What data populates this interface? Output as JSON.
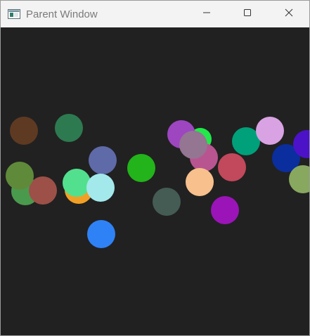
{
  "window": {
    "title": "Parent Window",
    "app_icon": "window-app-icon",
    "controls": [
      "minimize-icon",
      "maximize-icon",
      "close-icon"
    ]
  },
  "canvas": {
    "background": "#212121",
    "circles": [
      {
        "name": "circle-1",
        "color": "#5e3a22"
      },
      {
        "name": "circle-2",
        "color": "#2e7a50"
      },
      {
        "name": "circle-3",
        "color": "#5f6aa8"
      },
      {
        "name": "circle-4",
        "color": "#23b31a"
      },
      {
        "name": "circle-5",
        "color": "#4a9a4e"
      },
      {
        "name": "circle-6",
        "color": "#9c5048"
      },
      {
        "name": "circle-7",
        "color": "#5f8a3a"
      },
      {
        "name": "circle-8",
        "color": "#f2a025"
      },
      {
        "name": "circle-9",
        "color": "#52e08e"
      },
      {
        "name": "circle-10",
        "color": "#a3e9ec"
      },
      {
        "name": "circle-11",
        "color": "#455c55"
      },
      {
        "name": "circle-12",
        "color": "#2f82f6"
      },
      {
        "name": "circle-13",
        "color": "#22e84b"
      },
      {
        "name": "circle-14",
        "color": "#9d46c0"
      },
      {
        "name": "circle-15",
        "color": "#b85590"
      },
      {
        "name": "circle-16",
        "color": "#947592"
      },
      {
        "name": "circle-17",
        "color": "#f7c08c"
      },
      {
        "name": "circle-18",
        "color": "#c2485c"
      },
      {
        "name": "circle-19",
        "color": "#9a14b8"
      },
      {
        "name": "circle-20",
        "color": "#00a07a"
      },
      {
        "name": "circle-21",
        "color": "#d9a2e3"
      },
      {
        "name": "circle-22",
        "color": "#0a2e9e"
      },
      {
        "name": "circle-23",
        "color": "#4c12c8"
      },
      {
        "name": "circle-24",
        "color": "#88a860"
      }
    ]
  }
}
